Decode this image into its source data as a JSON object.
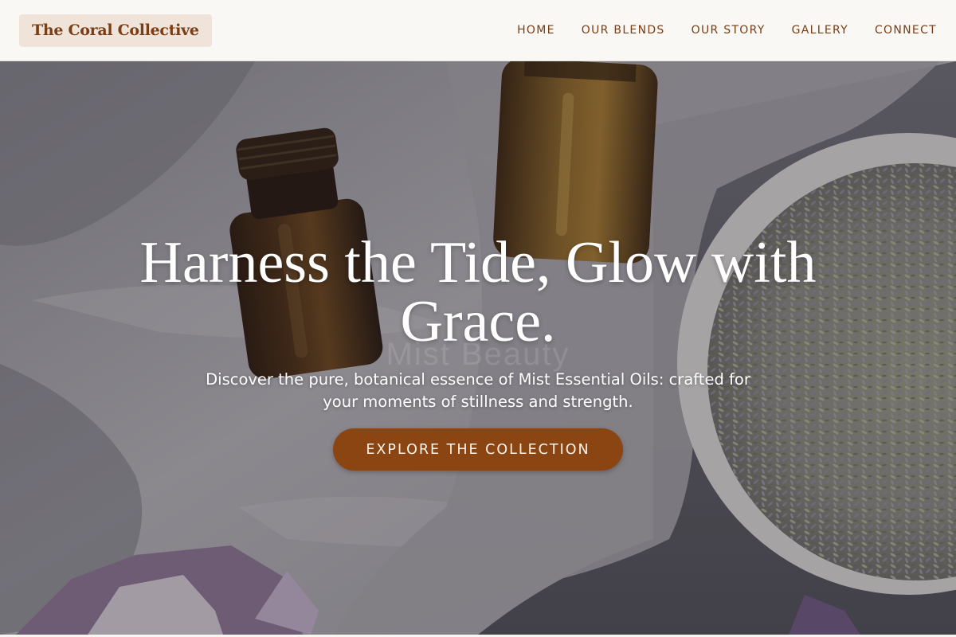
{
  "brand": {
    "name": "The Coral Collective"
  },
  "nav": {
    "items": [
      {
        "label": "HOME"
      },
      {
        "label": "OUR BLENDS"
      },
      {
        "label": "OUR STORY"
      },
      {
        "label": "GALLERY"
      },
      {
        "label": "CONNECT"
      }
    ]
  },
  "hero": {
    "title": "Harness the Tide, Glow with Grace.",
    "watermark": "Mist Beauty",
    "subtitle": "Discover the pure, botanical essence of Mist Essential Oils: crafted for your moments of stillness and strength.",
    "cta_label": "EXPLORE THE COLLECTION",
    "image_description": "amber-bottles-lavender-linen-photo"
  },
  "colors": {
    "accent": "#8b4513",
    "brand_text": "#7a3d14",
    "logo_bg": "#efe3da",
    "header_bg": "#f9f8f4"
  }
}
